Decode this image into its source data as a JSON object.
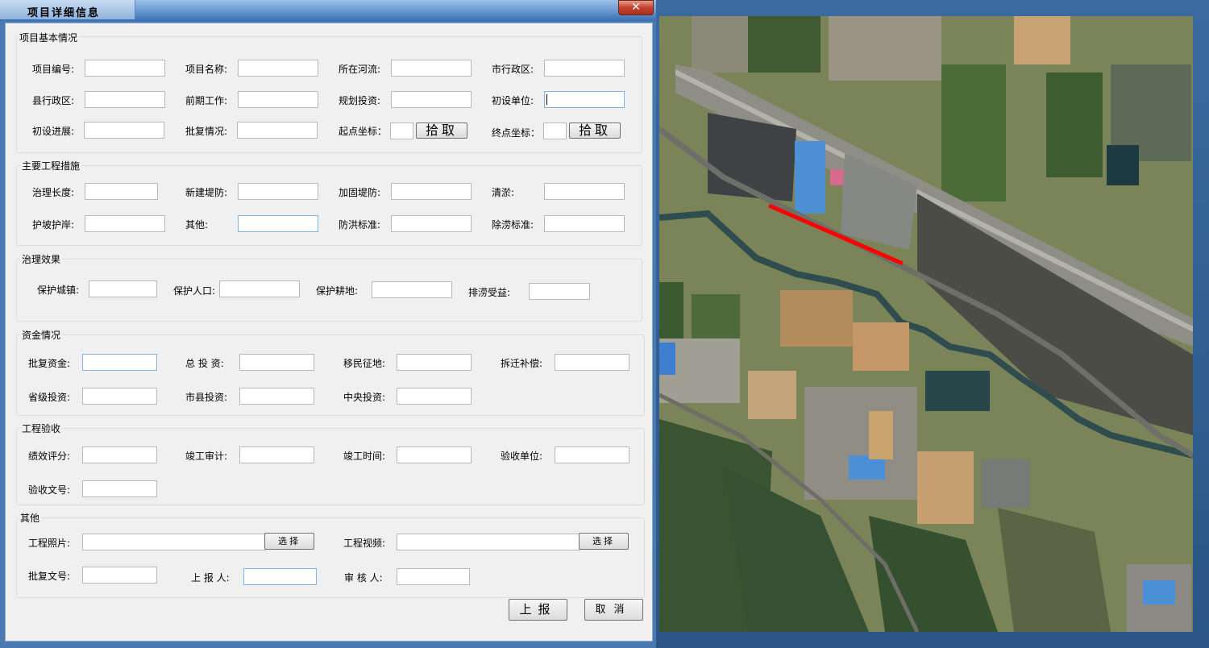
{
  "window": {
    "title": "项目详细信息",
    "close_glyph": "✕"
  },
  "sections": {
    "basic": "项目基本情况",
    "measures": "主要工程措施",
    "effect": "治理效果",
    "funding": "资金情况",
    "acceptance": "工程验收",
    "other": "其他"
  },
  "basic": {
    "project_no": "项目编号:",
    "project_name": "项目名称:",
    "river": "所在河流:",
    "city_district": "市行政区:",
    "county_district": "县行政区:",
    "prelim_work": "前期工作:",
    "planned_investment": "规划投资:",
    "design_unit": "初设单位:",
    "design_progress": "初设进展:",
    "approval_status": "批复情况:",
    "start_coord": "起点坐标：",
    "end_coord": "终点坐标：",
    "pick": "拾取"
  },
  "measures": {
    "length": "治理长度:",
    "new_dike": "新建堤防:",
    "reinforce_dike": "加固堤防:",
    "dredging": "清淤:",
    "slope_protection": "护坡护岸:",
    "other": "其他:",
    "flood_standard": "防洪标准:",
    "drainage_standard": "除涝标准:"
  },
  "effect": {
    "protect_town": "保护城镇:",
    "protect_population": "保护人口:",
    "protect_farmland": "保护耕地:",
    "drainage_benefit": "排涝受益:"
  },
  "funding": {
    "approved_funds": "批复资金:",
    "total_investment": "总 投 资:",
    "resettlement": "移民征地:",
    "demolition": "拆迁补偿:",
    "provincial": "省级投资:",
    "municipal": "市县投资:",
    "central": "中央投资:"
  },
  "acceptance": {
    "performance": "绩效评分:",
    "audit": "竣工审计:",
    "completion_time": "竣工时间:",
    "acceptance_unit": "验收单位:",
    "acceptance_doc": "验收文号:"
  },
  "other": {
    "photo": "工程照片:",
    "video": "工程视频:",
    "choose": "选择",
    "approval_doc": "批复文号:",
    "reporter": "上 报 人:",
    "reviewer": "审 核 人:"
  },
  "actions": {
    "submit": "上报",
    "cancel": "取消"
  },
  "colors": {
    "route_line": "#ff0000"
  }
}
